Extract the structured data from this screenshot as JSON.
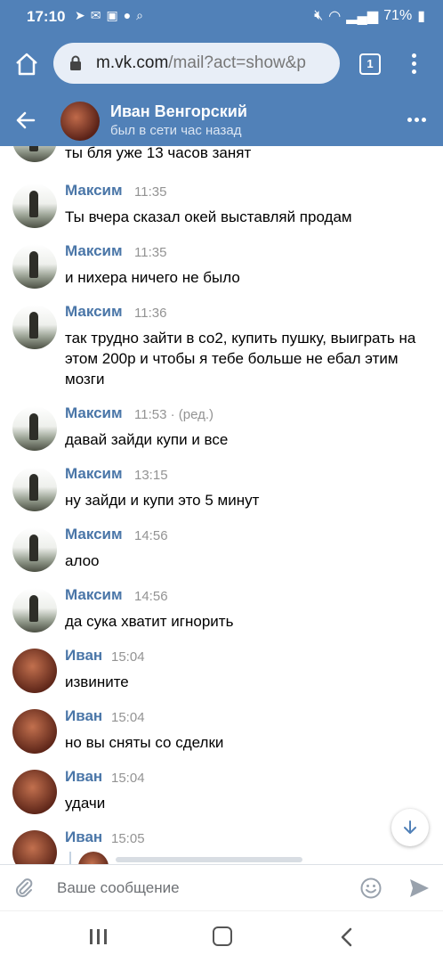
{
  "status_bar": {
    "time": "17:10",
    "battery": "71%"
  },
  "browser": {
    "url_host": "m.vk.com",
    "url_path": "/mail?act=show&p",
    "tab_count": "1"
  },
  "chat_header": {
    "name": "Иван Венгорский",
    "status": "был в сети час назад"
  },
  "messages": [
    {
      "author": "",
      "time": "",
      "text": "ты бля уже 13 часов занят",
      "avatar": "maxim"
    },
    {
      "author": "Максим",
      "time": "11:35",
      "text": "Ты вчера сказал окей выставляй продам",
      "avatar": "maxim"
    },
    {
      "author": "Максим",
      "time": "11:35",
      "text": "и нихера ничего не было",
      "avatar": "maxim"
    },
    {
      "author": "Максим",
      "time": "11:36",
      "text": "так трудно зайти в со2, купить пушку, выиграть на этом 200р и чтобы я тебе больше не ебал этим мозги",
      "avatar": "maxim"
    },
    {
      "author": "Максим",
      "time": "11:53 · (ред.)",
      "text": "давай зайди купи и все",
      "avatar": "maxim"
    },
    {
      "author": "Максим",
      "time": "13:15",
      "text": "ну зайди и купи это 5 минут",
      "avatar": "maxim"
    },
    {
      "author": "Максим",
      "time": "14:56",
      "text": "алоо",
      "avatar": "maxim"
    },
    {
      "author": "Максим",
      "time": "14:56",
      "text": "да сука хватит игнорить",
      "avatar": "maxim"
    },
    {
      "author": "Иван",
      "time": "15:04",
      "text": "извините",
      "avatar": "ivan"
    },
    {
      "author": "Иван",
      "time": "15:04",
      "text": "но вы сняты со сделки",
      "avatar": "ivan"
    },
    {
      "author": "Иван",
      "time": "15:04",
      "text": "удачи",
      "avatar": "ivan"
    },
    {
      "author": "Иван",
      "time": "15:05",
      "text": "",
      "avatar": "ivan"
    }
  ],
  "composer": {
    "placeholder": "Ваше сообщение"
  },
  "colors": {
    "header": "#5181b8",
    "author": "#4a76a8",
    "muted": "#939393"
  }
}
